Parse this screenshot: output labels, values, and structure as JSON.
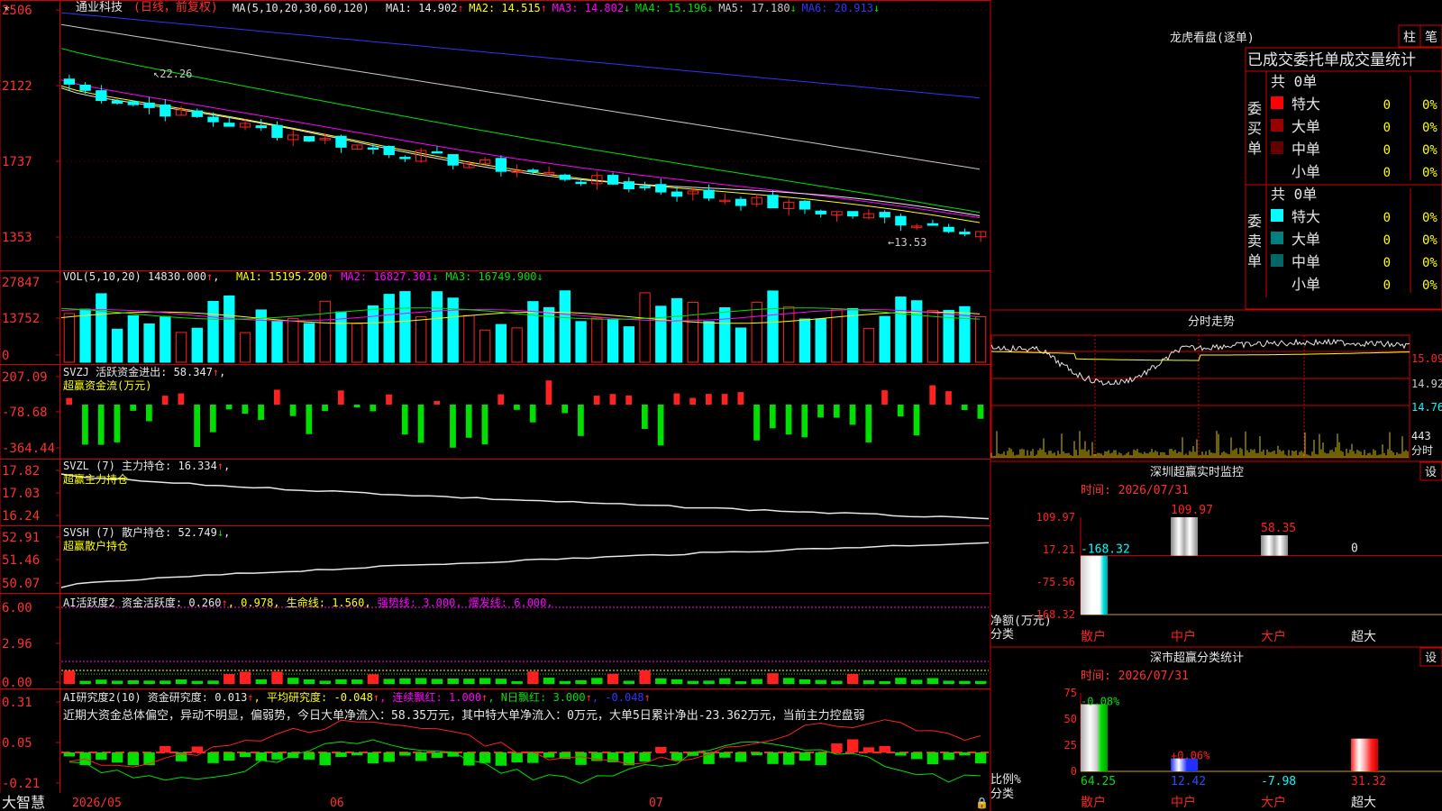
{
  "app_brand": "大智慧",
  "stock_name": "通业科技",
  "period_label": "(日线，前复权)",
  "main_panel": {
    "ma_header": "MA(5,10,20,30,60,120)",
    "ma_values": [
      {
        "label": "MA1: 14.902",
        "arrow": "↑",
        "color": "#e6e6e6"
      },
      {
        "label": "MA2: 14.515",
        "arrow": "↑",
        "color": "#ffff00"
      },
      {
        "label": "MA3: 14.802",
        "arrow": "↓",
        "color": "#ff00ff"
      },
      {
        "label": "MA4: 15.196",
        "arrow": "↓",
        "color": "#00e000"
      },
      {
        "label": "MA5: 17.180",
        "arrow": "↓",
        "color": "#c8c8c8"
      },
      {
        "label": "MA6: 20.913",
        "arrow": "↓",
        "color": "#3333ff"
      }
    ],
    "y_ticks": [
      "2506",
      "2122",
      "1737",
      "1353"
    ],
    "high_note": "22.26",
    "low_note": "13.53"
  },
  "vol_panel": {
    "header": "VOL(5,10,20)",
    "value": "14830.000",
    "ma_values": [
      {
        "label": "MA1: 15195.200",
        "arrow": "↑",
        "color": "#ffff00"
      },
      {
        "label": "MA2: 16827.301",
        "arrow": "↓",
        "color": "#ff00ff"
      },
      {
        "label": "MA3: 16749.900",
        "arrow": "↓",
        "color": "#00e000"
      }
    ],
    "y_ticks": [
      "27847",
      "13752",
      "0"
    ]
  },
  "svzj_panel": {
    "header": "SVZJ  活跃资金进出: 58.347",
    "subtitle": "超赢资金流(万元)",
    "y_ticks": [
      "207.09",
      "-78.68",
      "-364.44"
    ]
  },
  "svzl_panel": {
    "header": "SVZL (7) 主力持仓: 16.334",
    "subtitle": "超赢主力持仓",
    "y_ticks": [
      "17.82",
      "17.03",
      "16.24"
    ]
  },
  "svsh_panel": {
    "header": "SVSH (7) 散户持仓: 52.749",
    "subtitle": "超赢散户持仓",
    "y_ticks": [
      "52.91",
      "51.46",
      "50.07"
    ]
  },
  "ai1_panel": {
    "header_parts": [
      {
        "text": "AI活跃度2 资金活跃度: 0.260",
        "color": "#e6e6e6"
      },
      {
        "text": "↑",
        "color": "#ff3030"
      },
      {
        "text": ", 0.978, 生命线: 1.560,",
        "color": "#ffff00"
      },
      {
        "text": " 强势线: 3.000, 爆发线: 6.000,",
        "color": "#ff00ff"
      }
    ],
    "y_ticks": [
      "6.00",
      "2.96",
      "0.00"
    ]
  },
  "ai2_panel": {
    "header_parts": [
      {
        "text": "AI研究度2(10) 资金研究度: 0.013",
        "color": "#e6e6e6"
      },
      {
        "text": "↑",
        "color": "#ff3030"
      },
      {
        "text": ", 平均研究度: -0.048",
        "color": "#ffff00"
      },
      {
        "text": "↑",
        "color": "#ff3030"
      },
      {
        "text": ", 连续飘红: 1.000",
        "color": "#ff00ff"
      },
      {
        "text": "↑",
        "color": "#ff3030"
      },
      {
        "text": ", N日飘红: 3.000",
        "color": "#00e000"
      },
      {
        "text": "↑",
        "color": "#ff3030"
      },
      {
        "text": ", -0.048",
        "color": "#3333ff"
      },
      {
        "text": "↑",
        "color": "#ff3030"
      }
    ],
    "comment": "近期大资金总体偏空，异动不明显，偏弱势，今日大单净流入：58.35万元，其中特大单净流入：0万元，大单5日累计净出-23.362万元，当前主力控盘弱",
    "y_ticks": [
      "0.31",
      "0.05",
      "-0.21"
    ]
  },
  "x_axis_labels": [
    "2026/05",
    "06",
    "07"
  ],
  "right": {
    "dragon_title": "龙虎看盘(逐单)",
    "tab_zhu": "柱",
    "tab_bi": "笔",
    "trade_stats_title": "已成交委托单成交量统计",
    "buy_side": {
      "label": "委买单",
      "total": "共 0单",
      "rows": [
        {
          "name": "特大",
          "count": "0",
          "pct": "0%",
          "color": "#ff0000"
        },
        {
          "name": "大单",
          "count": "0",
          "pct": "0%",
          "color": "#990000"
        },
        {
          "name": "中单",
          "count": "0",
          "pct": "0%",
          "color": "#660000"
        },
        {
          "name": "小单",
          "count": "0",
          "pct": "0%",
          "color": ""
        }
      ]
    },
    "sell_side": {
      "label": "委卖单",
      "total": "共 0单",
      "rows": [
        {
          "name": "特大",
          "count": "0",
          "pct": "0%",
          "color": "#00ffff"
        },
        {
          "name": "大单",
          "count": "0",
          "pct": "0%",
          "color": "#008080"
        },
        {
          "name": "中单",
          "count": "0",
          "pct": "0%",
          "color": "#006666"
        },
        {
          "name": "小单",
          "count": "0",
          "pct": "0%",
          "color": ""
        }
      ]
    },
    "intraday_title": "分时走势",
    "intraday_y": [
      "15.09",
      "14.92",
      "14.76"
    ],
    "intraday_vol": "443",
    "intraday_unit": "分时",
    "monitor_title": "深圳超赢实时监控",
    "monitor_set": "设",
    "monitor_time": "时间: 2026/07/31",
    "monitor_y": [
      "109.97",
      "17.21",
      "-75.56",
      "-168.32"
    ],
    "monitor_axis_title": "净额(万元)",
    "monitor_axis_sub": "分类",
    "classify_title": "深市超赢分类统计",
    "classify_set": "设",
    "classify_time": "时间: 2026/07/31",
    "classify_y": [
      "75",
      "50",
      "25",
      "0"
    ],
    "classify_axis_title": "比例%",
    "classify_axis_sub": "分类"
  },
  "chart_data": [
    {
      "type": "bar",
      "title": "深圳超赢实时监控",
      "ylabel": "净额(万元)",
      "categories": [
        "散户",
        "中户",
        "大户",
        "超大"
      ],
      "values": [
        -168.32,
        109.97,
        58.35,
        0
      ],
      "value_labels": [
        "-168.32",
        "109.97",
        "58.35",
        "0"
      ],
      "ylim": [
        -168.32,
        109.97
      ]
    },
    {
      "type": "bar",
      "title": "深市超赢分类统计",
      "ylabel": "比例%",
      "categories": [
        "散户",
        "中户",
        "大户",
        "超大"
      ],
      "values": [
        64.25,
        12.42,
        -7.98,
        31.32
      ],
      "top_labels": [
        "-0.08%",
        "+0.06%",
        "",
        ""
      ],
      "ylim": [
        0,
        75
      ]
    }
  ]
}
